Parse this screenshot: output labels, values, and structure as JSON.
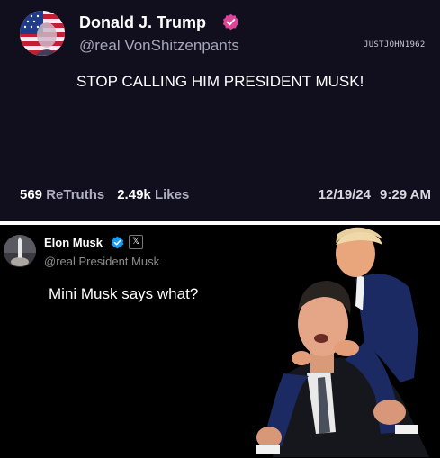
{
  "top_post": {
    "display_name": "Donald J. Trump",
    "handle": "@real VonShitzenpants",
    "watermark": "JUSTJOHN1962",
    "text": "STOP CALLING HIM PRESIDENT MUSK!",
    "retruths_count": "569",
    "retruths_label": "ReTruths",
    "likes_count": "2.49k",
    "likes_label": "Likes",
    "date": "12/19/24",
    "time": "9:29 AM",
    "verified_color": "#e0449a"
  },
  "bottom_post": {
    "display_name": "Elon Musk",
    "handle": "@real President Musk",
    "text": "Mini Musk says what?",
    "verified_color": "#1d9bf0",
    "affiliate_badge": "𝕏"
  }
}
